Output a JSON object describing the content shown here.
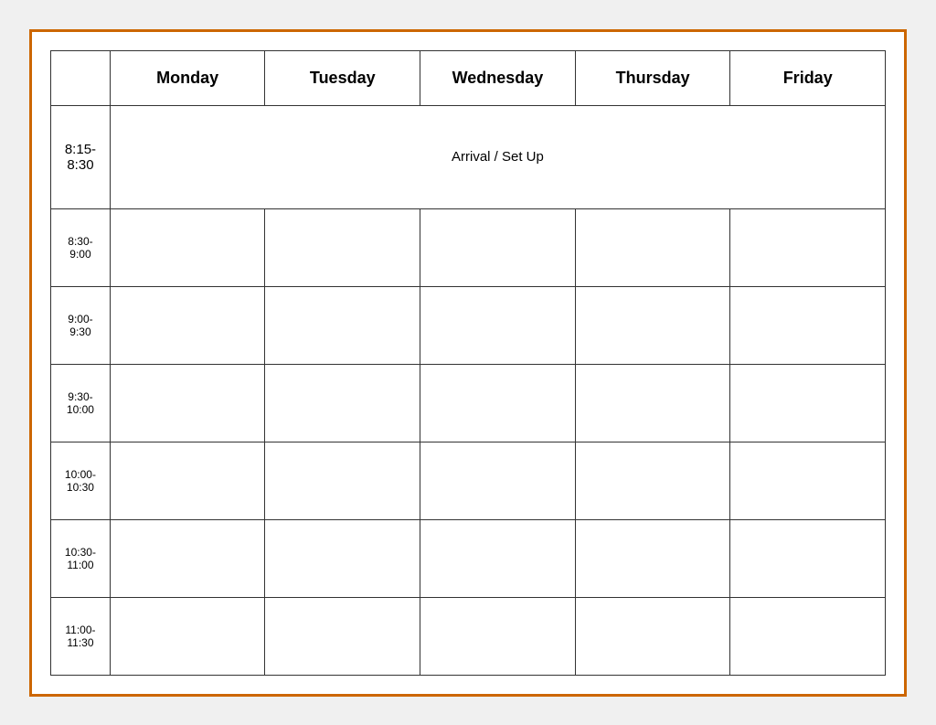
{
  "table": {
    "headers": {
      "time": "",
      "monday": "Monday",
      "tuesday": "Tuesday",
      "wednesday": "Wednesday",
      "thursday": "Thursday",
      "friday": "Friday"
    },
    "arrival_row": {
      "time": "8:15-\n8:30",
      "label": "Arrival / Set Up"
    },
    "rows": [
      {
        "time": "8:30-\n9:00"
      },
      {
        "time": "9:00-\n9:30"
      },
      {
        "time": "9:30-\n10:00"
      },
      {
        "time": "10:00-\n10:30"
      },
      {
        "time": "10:30-\n11:00"
      },
      {
        "time": "11:00-\n11:30"
      }
    ]
  }
}
